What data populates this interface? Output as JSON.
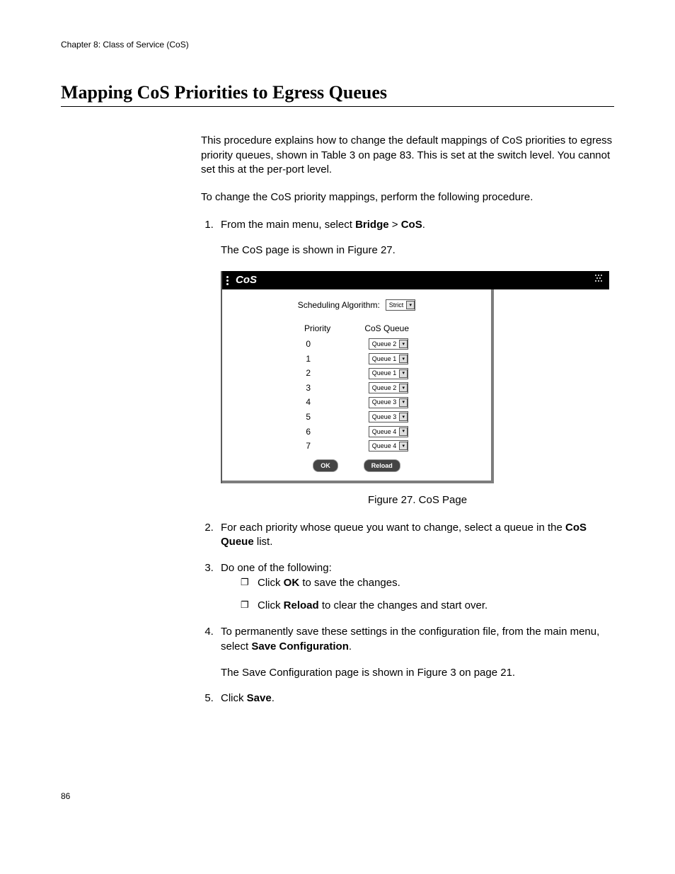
{
  "chapter_header": "Chapter 8: Class of Service (CoS)",
  "section_title": "Mapping CoS Priorities to Egress Queues",
  "intro_para": "This procedure explains how to change the default mappings of CoS priorities to egress priority queues, shown in Table 3 on page 83. This is set at the switch level. You cannot set this at the per-port level.",
  "lead_para": "To change the CoS priority mappings, perform the following procedure.",
  "step1_pre": "From the main menu, select ",
  "step1_b1": "Bridge",
  "step1_mid": " > ",
  "step1_b2": "CoS",
  "step1_post": ".",
  "step1_sub": "The CoS page is shown in Figure 27.",
  "cos": {
    "panel_title": "CoS",
    "sched_label": "Scheduling Algorithm:",
    "sched_value": "Strict",
    "col_priority": "Priority",
    "col_queue": "CoS Queue",
    "rows": [
      {
        "p": "0",
        "q": "Queue 2"
      },
      {
        "p": "1",
        "q": "Queue 1"
      },
      {
        "p": "2",
        "q": "Queue 1"
      },
      {
        "p": "3",
        "q": "Queue 2"
      },
      {
        "p": "4",
        "q": "Queue 3"
      },
      {
        "p": "5",
        "q": "Queue 3"
      },
      {
        "p": "6",
        "q": "Queue 4"
      },
      {
        "p": "7",
        "q": "Queue 4"
      }
    ],
    "btn_ok": "OK",
    "btn_reload": "Reload"
  },
  "figure_caption": "Figure 27. CoS Page",
  "step2_pre": "For each priority whose queue you want to change, select a queue in the ",
  "step2_b": "CoS Queue",
  "step2_post": " list.",
  "step3": "Do one of the following:",
  "step3a_pre": "Click ",
  "step3a_b": "OK",
  "step3a_post": " to save the changes.",
  "step3b_pre": "Click ",
  "step3b_b": "Reload",
  "step3b_post": " to clear the changes and start over.",
  "step4_pre": "To permanently save these settings in the configuration file, from the main menu, select ",
  "step4_b": "Save Configuration",
  "step4_post": ".",
  "step4_sub": "The Save Configuration page is shown in Figure 3 on page 21.",
  "step5_pre": "Click ",
  "step5_b": "Save",
  "step5_post": ".",
  "page_number": "86"
}
